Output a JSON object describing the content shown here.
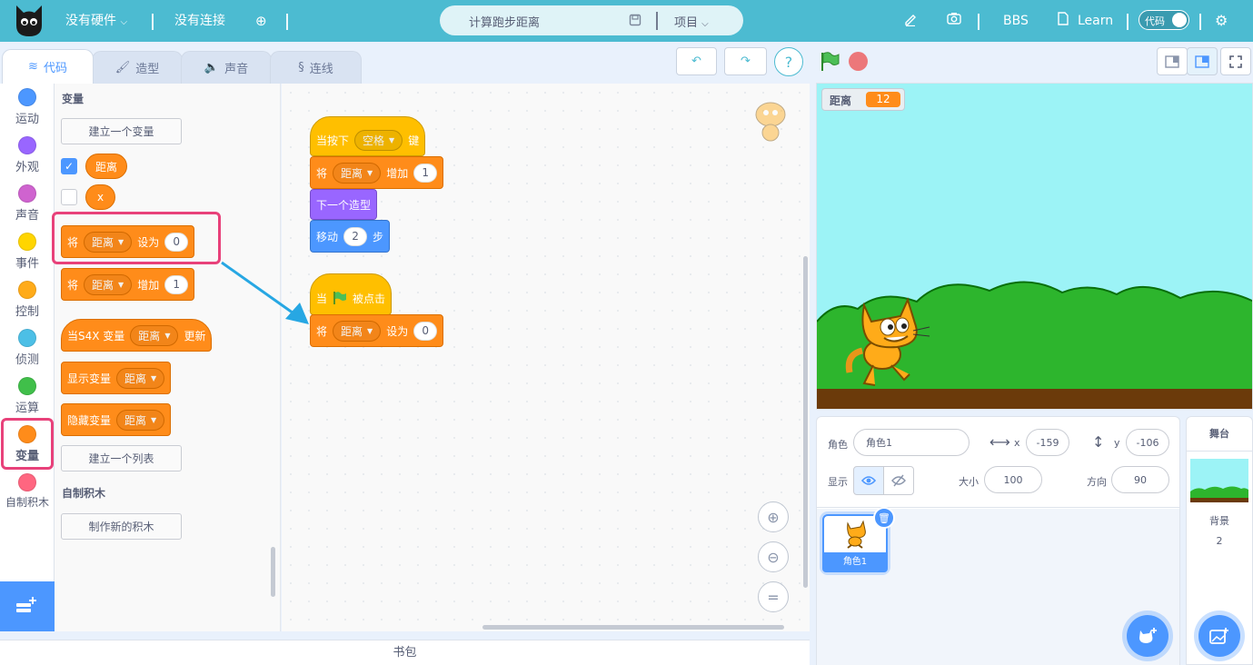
{
  "topbar": {
    "hardware": "没有硬件",
    "connection": "没有连接",
    "project_title": "计算跑步距离",
    "project_menu": "项目",
    "bbs": "BBS",
    "learn": "Learn",
    "mode_toggle": "代码",
    "accent": "#4cbbd1"
  },
  "tabs": [
    {
      "label": "代码"
    },
    {
      "label": "造型"
    },
    {
      "label": "声音"
    },
    {
      "label": "连线"
    }
  ],
  "categories": [
    {
      "label": "运动",
      "color": "#4c97ff"
    },
    {
      "label": "外观",
      "color": "#9966ff"
    },
    {
      "label": "声音",
      "color": "#cf63cf"
    },
    {
      "label": "事件",
      "color": "#ffd500"
    },
    {
      "label": "控制",
      "color": "#ffab19"
    },
    {
      "label": "侦测",
      "color": "#4cbfe6"
    },
    {
      "label": "运算",
      "color": "#40bf4a"
    },
    {
      "label": "变量",
      "color": "#ff8c1a"
    },
    {
      "label": "自制积木",
      "color": "#ff6680"
    }
  ],
  "palette": {
    "section_variables": "变量",
    "make_variable": "建立一个变量",
    "var_distance": "距离",
    "var_x": "x",
    "set_block": {
      "prefix": "将",
      "var": "距离",
      "mid": "设为",
      "value": "0"
    },
    "change_block": {
      "prefix": "将",
      "var": "距离",
      "mid": "增加",
      "value": "1"
    },
    "when_var_block": {
      "prefix": "当S4X 变量",
      "var": "距离",
      "suffix": "更新"
    },
    "show_var_block": {
      "prefix": "显示变量",
      "var": "距离"
    },
    "hide_var_block": {
      "prefix": "隐藏变量",
      "var": "距离"
    },
    "make_list": "建立一个列表",
    "section_custom": "自制积木",
    "make_block": "制作新的积木"
  },
  "script1": {
    "when_key": {
      "prefix": "当按下",
      "key": "空格",
      "suffix": "键"
    },
    "change": {
      "prefix": "将",
      "var": "距离",
      "mid": "增加",
      "value": "1"
    },
    "next_costume": "下一个造型",
    "move": {
      "prefix": "移动",
      "value": "2",
      "suffix": "步"
    }
  },
  "script2": {
    "when_flag": {
      "prefix": "当",
      "suffix": "被点击"
    },
    "set": {
      "prefix": "将",
      "var": "距离",
      "mid": "设为",
      "value": "0"
    }
  },
  "backpack": "书包",
  "stage": {
    "monitor_label": "距离",
    "monitor_value": "12"
  },
  "sprite_info": {
    "sprite_label": "角色",
    "sprite_name": "角色1",
    "x_label": "x",
    "x_value": "-159",
    "y_label": "y",
    "y_value": "-106",
    "show_label": "显示",
    "size_label": "大小",
    "size_value": "100",
    "direction_label": "方向",
    "direction_value": "90"
  },
  "sprite_tile": {
    "name": "角色1"
  },
  "stage_pane": {
    "title": "舞台",
    "backdrop_label": "背景",
    "backdrop_count": "2"
  }
}
